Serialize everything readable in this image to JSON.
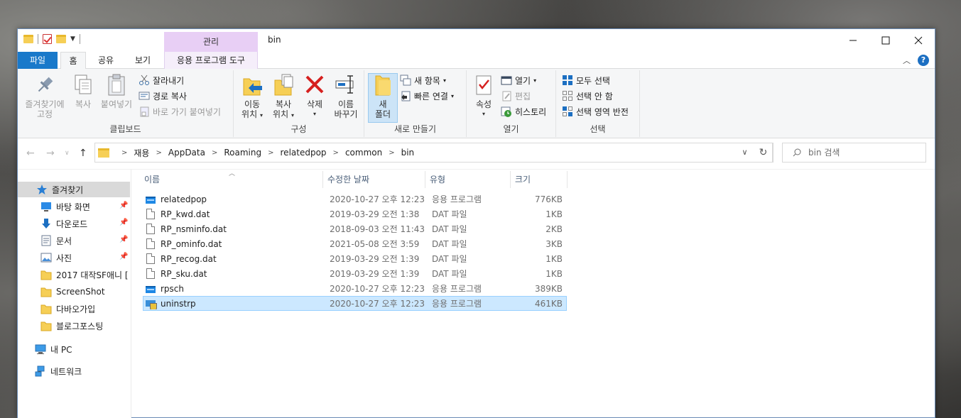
{
  "window": {
    "title": "bin",
    "contextual_tab_header": "관리"
  },
  "tabs": {
    "file": "파일",
    "home": "홈",
    "share": "공유",
    "view": "보기",
    "app_tools": "응용 프로그램 도구"
  },
  "ribbon": {
    "clipboard": {
      "label": "클립보드",
      "pin_line1": "즐겨찾기에",
      "pin_line2": "고정",
      "copy": "복사",
      "paste": "붙여넣기",
      "cut": "잘라내기",
      "copy_path": "경로 복사",
      "paste_shortcut": "바로 가기 붙여넣기"
    },
    "organize": {
      "label": "구성",
      "move_line1": "이동",
      "move_line2": "위치",
      "copy_line1": "복사",
      "copy_line2": "위치",
      "delete": "삭제",
      "rename_line1": "이름",
      "rename_line2": "바꾸기"
    },
    "new": {
      "label": "새로 만들기",
      "new_folder_line1": "새",
      "new_folder_line2": "폴더",
      "new_item": "새 항목",
      "easy_access": "빠른 연결"
    },
    "open": {
      "label": "열기",
      "properties": "속성",
      "open": "열기",
      "edit": "편집",
      "history": "히스토리"
    },
    "select": {
      "label": "선택",
      "select_all": "모두 선택",
      "select_none": "선택 안 함",
      "invert": "선택 영역 반전"
    }
  },
  "address": {
    "crumbs": [
      "재용",
      "AppData",
      "Roaming",
      "relatedpop",
      "common",
      "bin"
    ],
    "search_placeholder": "bin 검색"
  },
  "nav": {
    "quick_access": "즐겨찾기",
    "items": [
      {
        "label": "바탕 화면",
        "pinned": true
      },
      {
        "label": "다운로드",
        "pinned": true
      },
      {
        "label": "문서",
        "pinned": true
      },
      {
        "label": "사진",
        "pinned": true
      },
      {
        "label": "2017 대작SF애니 [",
        "pinned": false
      },
      {
        "label": "ScreenShot",
        "pinned": false
      },
      {
        "label": "다바오가입",
        "pinned": false
      },
      {
        "label": "블로그포스팅",
        "pinned": false
      }
    ],
    "this_pc": "내 PC",
    "network": "네트워크"
  },
  "columns": {
    "name": "이름",
    "date": "수정한 날짜",
    "type": "유형",
    "size": "크기"
  },
  "files": [
    {
      "name": "relatedpop",
      "date": "2020-10-27 오후 12:23",
      "type": "응용 프로그램",
      "size": "776KB",
      "icon": "exe-icon"
    },
    {
      "name": "RP_kwd.dat",
      "date": "2019-03-29 오전 1:38",
      "type": "DAT 파일",
      "size": "1KB",
      "icon": "document-icon"
    },
    {
      "name": "RP_nsminfo.dat",
      "date": "2018-09-03 오전 11:43",
      "type": "DAT 파일",
      "size": "2KB",
      "icon": "document-icon"
    },
    {
      "name": "RP_ominfo.dat",
      "date": "2021-05-08 오전 3:59",
      "type": "DAT 파일",
      "size": "3KB",
      "icon": "document-icon"
    },
    {
      "name": "RP_recog.dat",
      "date": "2019-03-29 오전 1:39",
      "type": "DAT 파일",
      "size": "1KB",
      "icon": "document-icon"
    },
    {
      "name": "RP_sku.dat",
      "date": "2019-03-29 오전 1:39",
      "type": "DAT 파일",
      "size": "1KB",
      "icon": "document-icon"
    },
    {
      "name": "rpsch",
      "date": "2020-10-27 오후 12:23",
      "type": "응용 프로그램",
      "size": "389KB",
      "icon": "exe-icon"
    },
    {
      "name": "uninstrp",
      "date": "2020-10-27 오후 12:23",
      "type": "응용 프로그램",
      "size": "461KB",
      "icon": "uninstaller-icon",
      "selected": true
    }
  ],
  "colors": {
    "file_tab": "#1979ca",
    "context_tab": "#e8cff5",
    "selection": "#cce8ff"
  }
}
